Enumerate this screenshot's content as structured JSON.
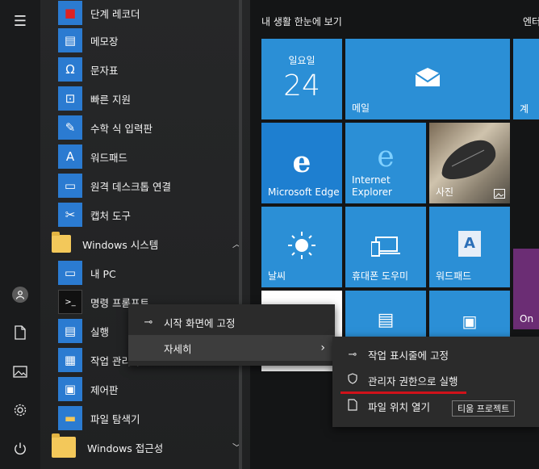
{
  "rail": {
    "menu_icon": "☰",
    "user_icon": "person-icon",
    "documents_icon": "document-icon",
    "pictures_icon": "pictures-icon",
    "settings_icon": "gear-icon",
    "power_icon": "power-icon"
  },
  "app_list": {
    "items": [
      {
        "label": "단계 레코더",
        "icon": "steps-recorder-icon",
        "glyph": "■"
      },
      {
        "label": "메모장",
        "icon": "notepad-icon",
        "glyph": "▤"
      },
      {
        "label": "문자표",
        "icon": "character-map-icon",
        "glyph": "Ω"
      },
      {
        "label": "빠른 지원",
        "icon": "quick-assist-icon",
        "glyph": "⊡"
      },
      {
        "label": "수학 식 입력판",
        "icon": "math-input-icon",
        "glyph": "✎"
      },
      {
        "label": "워드패드",
        "icon": "wordpad-icon",
        "glyph": "A"
      },
      {
        "label": "원격 데스크톱 연결",
        "icon": "remote-desktop-icon",
        "glyph": "▭"
      },
      {
        "label": "캡처 도구",
        "icon": "snipping-tool-icon",
        "glyph": "✂"
      }
    ],
    "folder_windows_system": "Windows 시스템",
    "system_items": [
      {
        "label": "내 PC",
        "icon": "this-pc-icon",
        "glyph": "▭"
      },
      {
        "label": "명령 프롬프트",
        "icon": "command-prompt-icon",
        "glyph": ">_"
      },
      {
        "label": "실행",
        "icon": "run-icon",
        "glyph": "▤"
      },
      {
        "label": "작업 관리자",
        "icon": "task-manager-icon",
        "glyph": "▦"
      },
      {
        "label": "제어판",
        "icon": "control-panel-icon",
        "glyph": "▣"
      },
      {
        "label": "파일 탐색기",
        "icon": "file-explorer-icon",
        "glyph": "▬"
      }
    ],
    "folder_accessibility": "Windows 접근성"
  },
  "tiles": {
    "group1_title": "내 생활 한눈에 보기",
    "group2_title": "엔터",
    "calendar_day": "일요일",
    "calendar_date": "24",
    "mail": "메일",
    "edge": "Microsoft Edge",
    "ie": "Internet Explorer",
    "photos": "사진",
    "weather": "날씨",
    "phone": "휴대폰 도우미",
    "wordpad": "워드패드",
    "partial_label1": "계",
    "partial_label2": "On",
    "colors": {
      "tile_blue": "#2b8fd6",
      "purple": "#6b2d74"
    }
  },
  "context_menu": {
    "pin_start": "시작 화면에 고정",
    "more": "자세히"
  },
  "submenu": {
    "pin_taskbar": "작업 표시줄에 고정",
    "run_admin": "관리자 권한으로 실행",
    "open_location": "파일 위치 열기"
  },
  "tooltip": "티움 프로젝트"
}
